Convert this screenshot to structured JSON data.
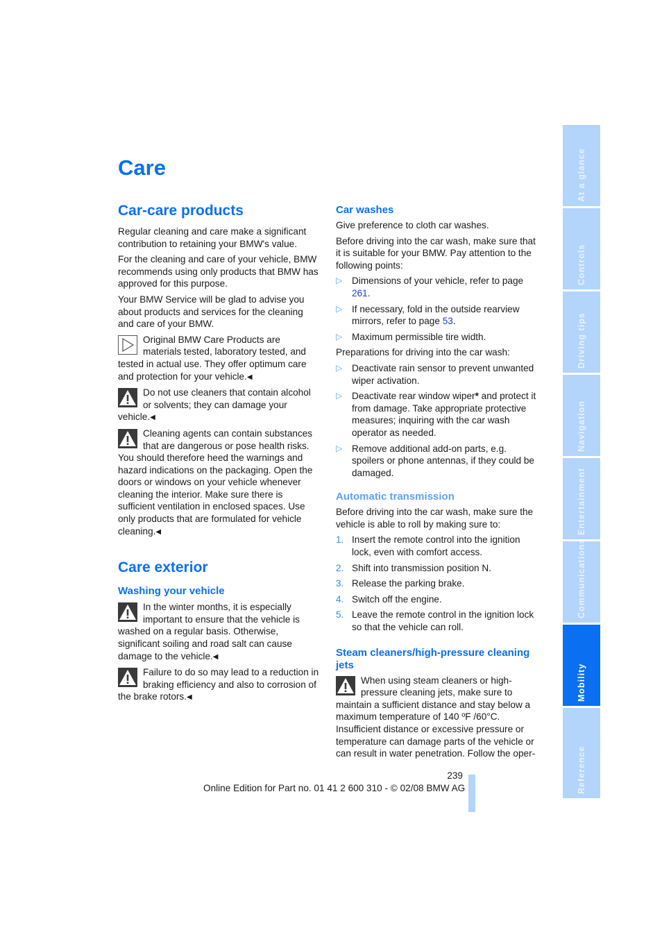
{
  "page": {
    "title": "Care",
    "page_number": "239",
    "footer": "Online Edition for Part no. 01 41 2 600 310 - © 02/08 BMW AG",
    "accent_color": "#0a6ff0",
    "tab_color": "#b3d4fb"
  },
  "left": {
    "section1_title": "Car-care products",
    "p1": "Regular cleaning and care make a significant contribution to retaining your BMW's value.",
    "p2": "For the cleaning and care of your vehicle, BMW recommends using only products that BMW has approved for this purpose.",
    "p3": "Your BMW Service will be glad to advise you about products and services for the cleaning and care of your BMW.",
    "note1": {
      "icon": "note-triangle-icon",
      "text": "Original BMW Care Products are materials tested, laboratory tested, and tested in actual use. They offer optimum care and protection for your vehicle."
    },
    "warn1": {
      "icon": "warning-icon",
      "text": "Do not use cleaners that contain alcohol or solvents; they can damage your vehicle."
    },
    "warn2": {
      "icon": "warning-icon",
      "text": "Cleaning agents can contain substances that are dangerous or pose health risks. You should therefore heed the warnings and hazard indications on the packaging. Open the doors or windows on your vehicle whenever cleaning the interior. Make sure there is sufficient ventilation in enclosed spaces. Use only products that are formulated for vehicle cleaning."
    },
    "section2_title": "Care exterior",
    "sub1_title": "Washing your vehicle",
    "warn3": {
      "icon": "warning-icon",
      "text": "In the winter months, it is especially important to ensure that the vehicle is washed on a regular basis. Otherwise, significant soiling and road salt can cause damage to the vehicle."
    },
    "warn4": {
      "icon": "warning-icon",
      "text": "Failure to do so may lead to a reduction in braking efficiency and also to corrosion of the brake rotors."
    },
    "end_mark": "◀"
  },
  "right": {
    "car_washes_title": "Car washes",
    "cw_p1": "Give preference to cloth car washes.",
    "cw_p2": "Before driving into the car wash, make sure that it is suitable for your BMW. Pay attention to the following points:",
    "cw_list": [
      {
        "text": "Dimensions of your vehicle, refer to page ",
        "link": "261",
        "after": "."
      },
      {
        "text": "If necessary, fold in the outside rearview mirrors, refer to page ",
        "link": "53",
        "after": "."
      },
      {
        "text": "Maximum permissible tire width.",
        "link": "",
        "after": ""
      }
    ],
    "prep_intro": "Preparations for driving into the car wash:",
    "prep_list": [
      {
        "text": "Deactivate rain sensor to prevent unwanted wiper activation."
      },
      {
        "text_a": "Deactivate rear window wiper",
        "star": "*",
        "text_b": " and protect it from damage. Take appropriate protective measures; inquiring with the car wash operator as needed."
      },
      {
        "text": "Remove additional add-on parts, e.g. spoilers or phone antennas, if they could be damaged."
      }
    ],
    "auto_title": "Automatic transmission",
    "auto_intro": "Before driving into the car wash, make sure the vehicle is able to roll by making sure to:",
    "auto_steps": [
      {
        "n": "1.",
        "text": "Insert the remote control into the ignition lock, even with comfort access."
      },
      {
        "n": "2.",
        "text": "Shift into transmission position N."
      },
      {
        "n": "3.",
        "text": "Release the parking brake."
      },
      {
        "n": "4.",
        "text": "Switch off the engine."
      },
      {
        "n": "5.",
        "text": "Leave the remote control in the ignition lock so that the vehicle can roll."
      }
    ],
    "steam_title": "Steam cleaners/high-pressure cleaning jets",
    "steam_warn": {
      "icon": "warning-icon",
      "text": "When using steam cleaners or high-pressure cleaning jets, make sure to maintain a sufficient distance and stay below a maximum temperature of 140 ºF /60°C."
    },
    "steam_p": "Insufficient distance or excessive pressure or temperature can damage parts of the vehicle or can result in water penetration. Follow the oper-",
    "bullet_marker": "▷"
  },
  "side_tabs": [
    {
      "label": "At a glance",
      "active": false
    },
    {
      "label": "Controls",
      "active": false
    },
    {
      "label": "Driving tips",
      "active": false
    },
    {
      "label": "Navigation",
      "active": false
    },
    {
      "label": "Entertainment",
      "active": false
    },
    {
      "label": "Communications",
      "active": false
    },
    {
      "label": "Mobility",
      "active": true
    },
    {
      "label": "Reference",
      "active": false
    }
  ]
}
